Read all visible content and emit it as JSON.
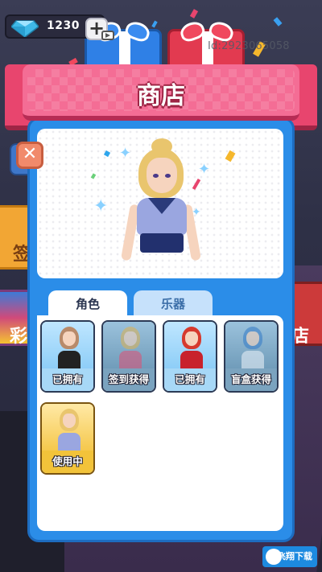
{
  "top_bar": {
    "currency_value": "1230",
    "add_label": "+",
    "player_id": "Id:2923065058"
  },
  "shop": {
    "title": "商店",
    "close_label": "✕"
  },
  "tabs": [
    {
      "label": "角色",
      "active": true
    },
    {
      "label": "乐器",
      "active": false
    }
  ],
  "characters": [
    {
      "status": "已拥有",
      "state": "owned",
      "hair": "#b88a6a",
      "outfit": "#222"
    },
    {
      "status": "签到获得",
      "state": "locked",
      "hair": "#d9b25a",
      "outfit": "#d8567a"
    },
    {
      "status": "已拥有",
      "state": "owned",
      "hair": "#d63a2e",
      "outfit": "#c8222c"
    },
    {
      "status": "盲盒获得",
      "state": "locked",
      "hair": "#3a7fc8",
      "outfit": "#e6eef6"
    },
    {
      "status": "使用中",
      "state": "inuse",
      "hair": "#e9c56d",
      "outfit": "#9aa6e0"
    }
  ],
  "background_labels": {
    "left_top": "签",
    "left_bottom": "彩",
    "right": "店"
  },
  "watermark": "飞翔下载",
  "colors": {
    "panel_blue": "#2b8de8",
    "banner_pink": "#f46d95",
    "owned_card": "#a7d8f7",
    "in_use_card": "#f2c33a"
  }
}
